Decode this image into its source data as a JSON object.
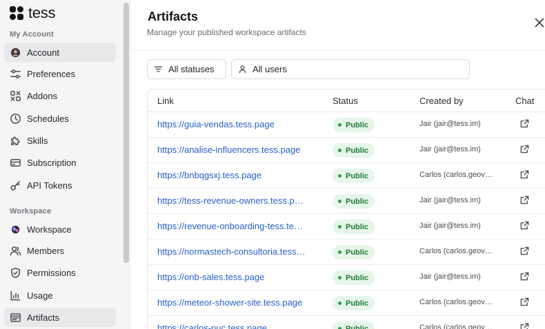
{
  "app": {
    "name": "tess"
  },
  "sidebar": {
    "account_section": "My Account",
    "workspace_section": "Workspace",
    "account_items": [
      {
        "label": "Account",
        "icon": "avatar-icon",
        "active": true
      },
      {
        "label": "Preferences",
        "icon": "sliders-icon"
      },
      {
        "label": "Addons",
        "icon": "addons-icon"
      },
      {
        "label": "Schedules",
        "icon": "clock-icon"
      },
      {
        "label": "Skills",
        "icon": "puzzle-icon"
      },
      {
        "label": "Subscription",
        "icon": "credit-card-icon"
      },
      {
        "label": "API Tokens",
        "icon": "key-icon"
      }
    ],
    "workspace_items": [
      {
        "label": "Workspace",
        "icon": "workspace-avatar-icon"
      },
      {
        "label": "Members",
        "icon": "users-icon"
      },
      {
        "label": "Permissions",
        "icon": "shield-icon"
      },
      {
        "label": "Usage",
        "icon": "bar-chart-icon"
      },
      {
        "label": "Artifacts",
        "icon": "artifacts-icon",
        "active": true
      }
    ]
  },
  "main": {
    "title": "Artifacts",
    "subtitle": "Manage your published workspace artifacts",
    "filters": {
      "status": "All statuses",
      "users": "All users"
    },
    "columns": [
      "Link",
      "Status",
      "Created by",
      "Chat"
    ],
    "rows": [
      {
        "link": "https://guia-vendas.tess.page",
        "status": "Public",
        "created_by": "Jair (jair@tess.im)"
      },
      {
        "link": "https://analise-influencers.tess.page",
        "status": "Public",
        "created_by": "Jair (jair@tess.im)"
      },
      {
        "link": "https://bnbqgsxj.tess.page",
        "status": "Public",
        "created_by": "Carlos (carlos.geov…"
      },
      {
        "link": "https://tess-revenue-owners.tess.p…",
        "status": "Public",
        "created_by": "Jair (jair@tess.im)"
      },
      {
        "link": "https://revenue-onboarding-tess.te…",
        "status": "Public",
        "created_by": "Jair (jair@tess.im)"
      },
      {
        "link": "https://normastech-consultoria.tess…",
        "status": "Public",
        "created_by": "Carlos (carlos.geov…"
      },
      {
        "link": "https://onb-sales.tess.page",
        "status": "Public",
        "created_by": "Jair (jair@tess.im)"
      },
      {
        "link": "https://meteor-shower-site.tess.page",
        "status": "Public",
        "created_by": "Carlos (carlos.geov…"
      },
      {
        "link": "https://carlos-puc.tess.page",
        "status": "Public",
        "created_by": "Carlos (carlos.geov…"
      }
    ]
  },
  "colors": {
    "link": "#2860c8",
    "badge_bg": "#e6f6ea",
    "badge_text": "#1f7a3a",
    "sidebar_bg": "#f5f5f6"
  }
}
